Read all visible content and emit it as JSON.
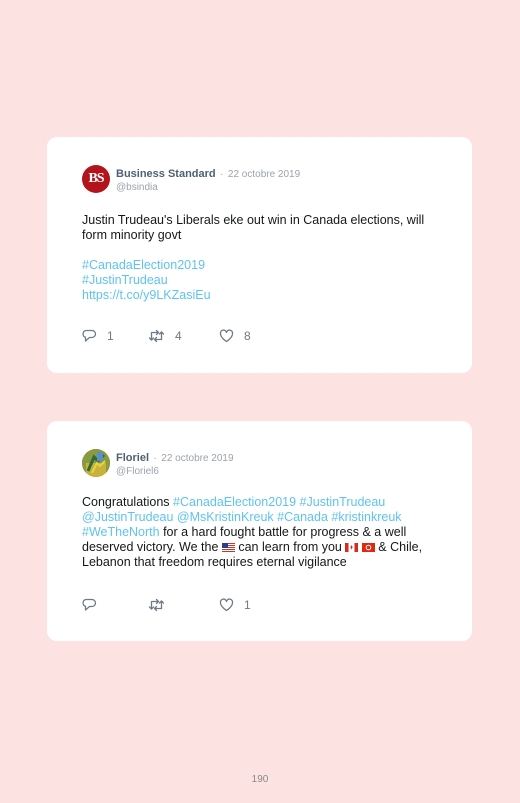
{
  "tweets": [
    {
      "author": "Business Standard",
      "separator": "·",
      "date": "22 octobre 2019",
      "handle": "@bsindia",
      "avatar_text": "BS",
      "text_line1": "Justin Trudeau's Liberals eke out win in Canada elections, will form minority govt",
      "hashtag1": "#CanadaElection2019",
      "hashtag2": "#JustinTrudeau",
      "link": "https://t.co/y9LKZasiEu",
      "replies": "1",
      "retweets": "4",
      "likes": "8"
    },
    {
      "author": "Floriel",
      "separator": "·",
      "date": "22 octobre 2019",
      "handle": "@Floriel6",
      "text": {
        "intro": "Congratulations ",
        "tag1": "#CanadaElection2019",
        "tag2": "#JustinTrudeau",
        "mention1": "@JustinTrudeau",
        "mention2": "@MsKristinKreuk",
        "tag3": "#Canada",
        "tag4": "#kristinkreuk",
        "tag5": "#WeTheNorth",
        "rest1": " for a hard fought battle for progress & a well deserved victory. We the ",
        "rest2": " can learn from you ",
        "rest3": " & Chile, Lebanon that freedom requires eternal vigilance"
      },
      "replies": "",
      "retweets": "",
      "likes": "1"
    }
  ],
  "page_number": "190",
  "colors": {
    "background": "#fde2e2",
    "link": "#5ec3ef",
    "card": "#ffffff"
  },
  "icons": [
    "reply-icon",
    "retweet-icon",
    "like-icon",
    "us-flag-icon",
    "canada-flag-icon",
    "hongkong-flag-icon"
  ]
}
